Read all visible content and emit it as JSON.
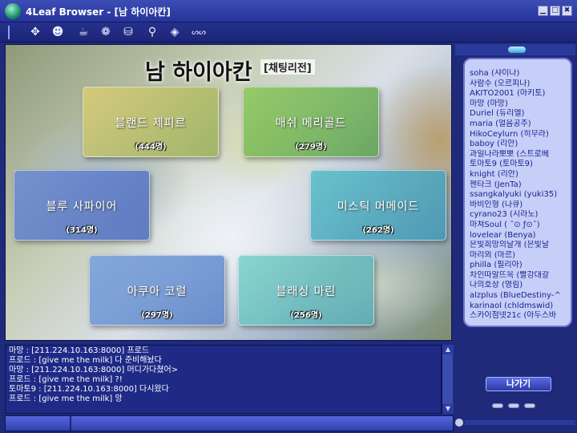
{
  "window": {
    "title": "4Leaf Browser - [남 하이아칸]",
    "buttons": {
      "minimize": "▁",
      "maximize": "□",
      "close": "✖"
    }
  },
  "toolbar": {
    "icons": [
      "arrows-icon",
      "person-icon",
      "cup-icon",
      "globe-icon",
      "treasure-icon",
      "search-icon",
      "diamond-icon",
      "chain-icon"
    ],
    "glyphs": [
      "✥",
      "☻",
      "☕",
      "❁",
      "⛁",
      "⚲",
      "◈",
      "ᔕᔕ"
    ]
  },
  "map": {
    "title": "남 하이아칸",
    "subtitle": "[채팅리전]",
    "rooms": [
      {
        "name": "블랜드 제피르",
        "count": "(444명)"
      },
      {
        "name": "매쉬 메리골드",
        "count": "(279명)"
      },
      {
        "name": "블루 사파이어",
        "count": "(314명)"
      },
      {
        "name": "미스틱 머메이드",
        "count": "(262명)"
      },
      {
        "name": "아쿠아 코럴",
        "count": "(297명)"
      },
      {
        "name": "블래싱 마린",
        "count": "(256명)"
      }
    ]
  },
  "users": [
    "soha (샤이나)",
    "사람수 (오르피나)",
    "AKITO2001 (아키토)",
    "마망 (마망)",
    "Duriel (듀리엘)",
    "maria (얼음공주)",
    "HikoCeylurn (히무라)",
    "baboy (리안)",
    "과일나라뽀뽀 (스트로베",
    "토마토9 (토마토9)",
    "knight (리안)",
    "젠타크 (JenTa)",
    "ssangkalyuki (yuki35)",
    "바비인형 (나큐)",
    "cyrano23 (시라노)",
    "마쳐Soul ( ˆ⊙ ƒ⊙ˆ)",
    "lovelear (Benya)",
    "은빛희망의날개 (은빛날",
    "마리뫼 (마르)",
    "philla (필리아)",
    "차인따알뜨옥 (빨강대갈",
    "나의호상 (영림)",
    "alzplus (BlueDestiny-^",
    "karinaol (chldmswid)",
    "스카이점넷21c (아두스바"
  ],
  "exit_label": "나가기",
  "chat": {
    "lines": [
      "마망 : [211.224.10.163:8000] 프로드",
      "프로드 : [give me the milk] 다 준비해놨다",
      "마망 : [211.224.10.163:8000] 머디가다쳤어>",
      "프로드 : [give me the milk] ?!",
      "토마토9 : [211.224.10.163:8000] 다시왔다",
      "프로드 : [give me the milk] 앙"
    ],
    "scroll_up": "▲",
    "scroll_down": "▼",
    "input_value": ""
  }
}
